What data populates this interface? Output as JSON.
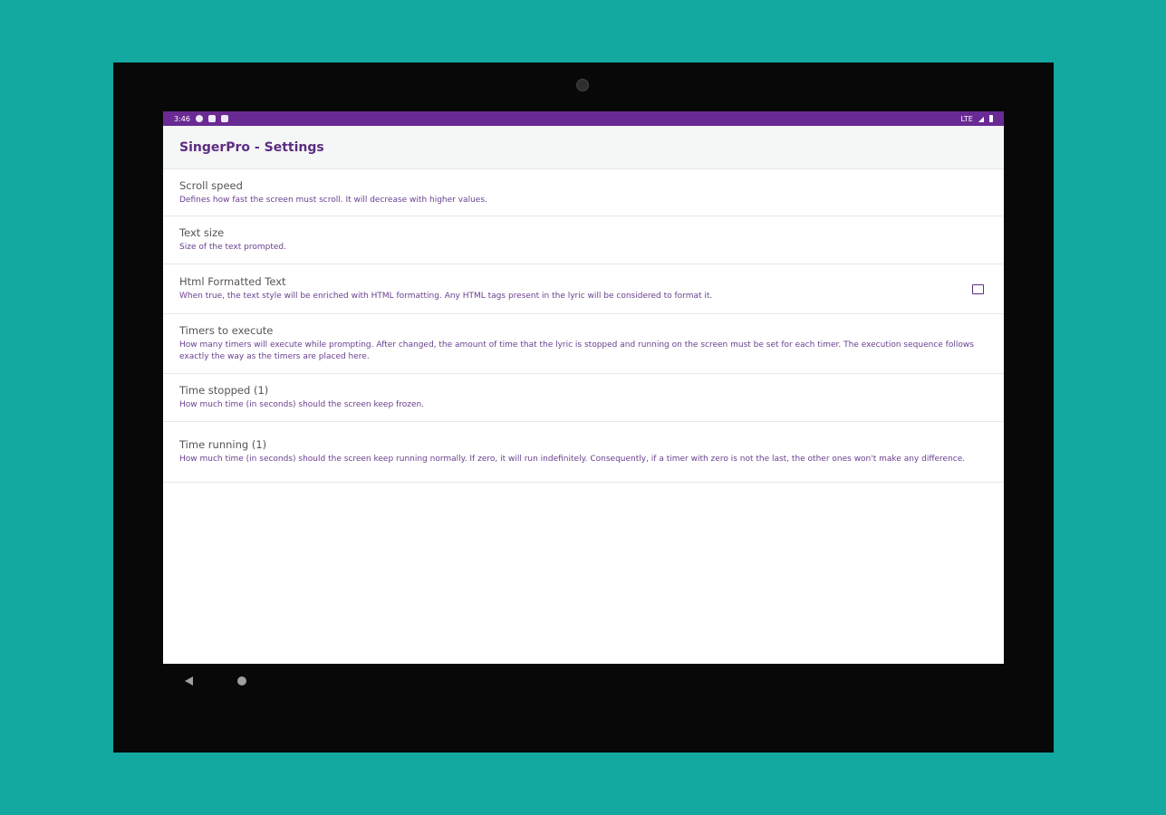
{
  "status_bar": {
    "time": "3:46",
    "signal": "LTE"
  },
  "appbar": {
    "title": "SingerPro - Settings"
  },
  "preferences": [
    {
      "title": "Scroll speed",
      "summary": "Defines how fast the screen must scroll. It will decrease with higher values."
    },
    {
      "title": "Text size",
      "summary": "Size of the text prompted."
    },
    {
      "title": "Html Formatted Text",
      "summary": "When true, the text style will be enriched with HTML formatting. Any HTML tags present in the lyric will be considered to format it.",
      "checked": false
    },
    {
      "title": "Timers to execute",
      "summary": "How many timers will execute while prompting. After changed, the amount of time that the lyric is stopped and running on the screen must be set for each timer. The execution sequence follows exactly the way as the timers are placed here."
    },
    {
      "title": "Time stopped (1)",
      "summary": "How much time (in seconds) should the screen keep frozen."
    },
    {
      "title": "Time running (1)",
      "summary": "How much time (in seconds) should the screen keep running normally. If zero, it will run indefinitely. Consequently, if a timer with zero is not the last, the other ones won't make any difference."
    }
  ],
  "icons": {
    "status_left": [
      "gear-icon",
      "notification-icon",
      "clipboard-icon"
    ],
    "status_right": [
      "wifi-icon",
      "battery-icon"
    ],
    "nav": [
      "back-icon",
      "home-icon"
    ]
  },
  "colors": {
    "background": "#13a8a0",
    "status_bar": "#6a2a94",
    "accent": "#5c2d82",
    "summary_text": "#6a3f8e"
  }
}
